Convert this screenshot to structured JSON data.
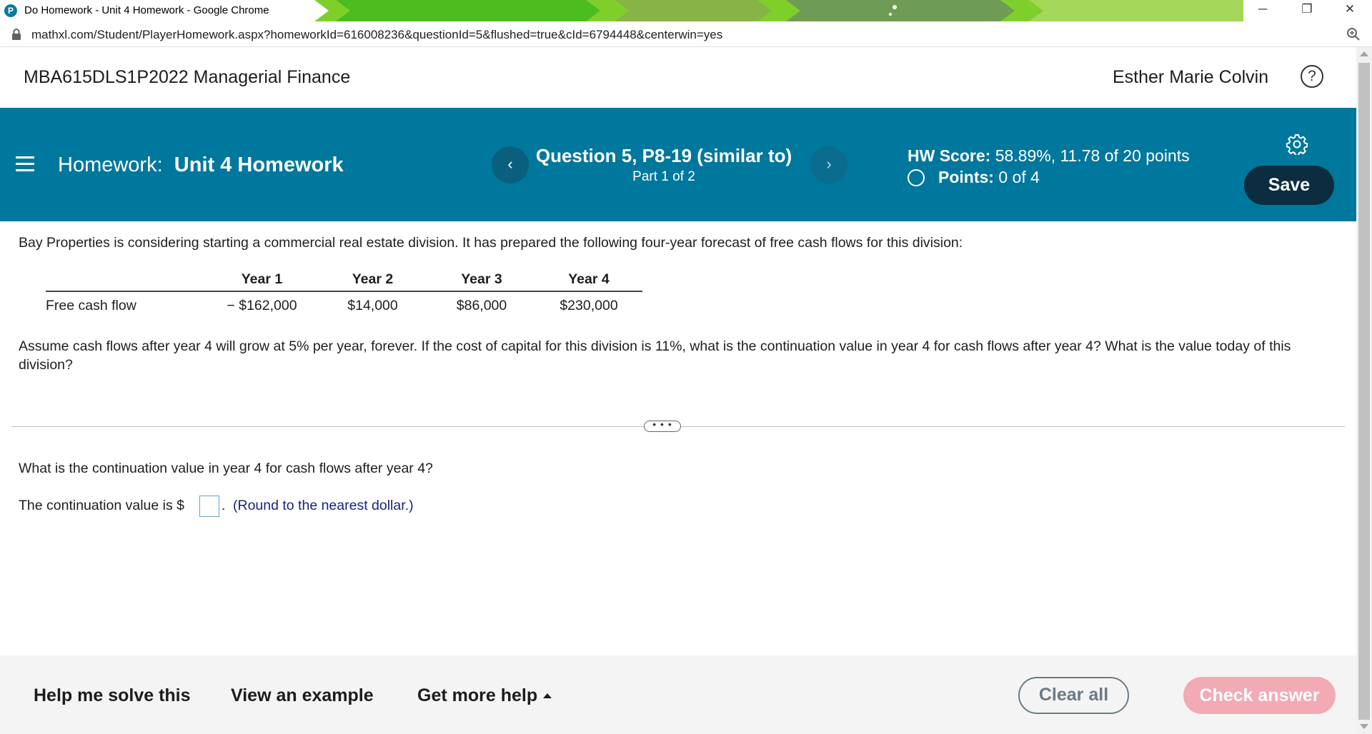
{
  "window": {
    "title": "Do Homework - Unit 4 Homework - Google Chrome",
    "favicon_letter": "P",
    "minimize": "─",
    "maximize": "❐",
    "close": "✕"
  },
  "browser": {
    "url": "mathxl.com/Student/PlayerHomework.aspx?homeworkId=616008236&questionId=5&flushed=true&cId=6794448&centerwin=yes"
  },
  "header": {
    "course": "MBA615DLS1P2022 Managerial Finance",
    "user": "Esther Marie Colvin",
    "help_symbol": "?"
  },
  "homework_bar": {
    "label": "Homework:",
    "name": "Unit 4 Homework",
    "prev_symbol": "‹",
    "next_symbol": "›",
    "question_title": "Question 5, P8-19 (similar to)",
    "part": "Part 1 of 2",
    "hw_score_label": "HW Score:",
    "hw_score_value": "58.89%, 11.78 of 20 points",
    "points_label": "Points:",
    "points_value": "0 of 4",
    "save_label": "Save"
  },
  "question": {
    "intro": "Bay Properties is considering starting a commercial real estate division. It has prepared the following four-year forecast of free cash flows for this division:",
    "table": {
      "headers": [
        "",
        "Year 1",
        "Year 2",
        "Year 3",
        "Year 4"
      ],
      "rows": [
        [
          "Free cash flow",
          "− $162,000",
          "$14,000",
          "$86,000",
          "$230,000"
        ]
      ]
    },
    "assumption": "Assume cash flows after year 4 will grow at 5% per year, forever. If the cost of capital for this division is 11%, what is the continuation value in year 4 for cash flows after year 4?  What is the value today of this division?",
    "expand_symbol": "• • •",
    "part_question": "What is the continuation value in year 4 for cash flows after year 4?",
    "answer_prefix": "The continuation value is $",
    "answer_value": "",
    "answer_suffix": ".",
    "hint": "(Round to the nearest dollar.)"
  },
  "footer": {
    "help_me_solve": "Help me solve this",
    "view_example": "View an example",
    "get_more_help": "Get more help",
    "clear_all": "Clear all",
    "check_answer": "Check answer"
  },
  "colors": {
    "brand_teal": "#00779c",
    "save_button": "#0b2d3f",
    "check_answer_disabled": "#f2aab5",
    "hint_text": "#1a237e"
  },
  "icons": {
    "favicon": "pearson-p-icon",
    "lock": "lock-icon",
    "zoom": "zoom-icon",
    "help": "help-circle-icon",
    "menu": "hamburger-menu-icon",
    "settings": "gear-icon",
    "points_status": "empty-circle-icon",
    "prev": "chevron-left-icon",
    "next": "chevron-right-icon",
    "more_help": "caret-up-icon"
  }
}
